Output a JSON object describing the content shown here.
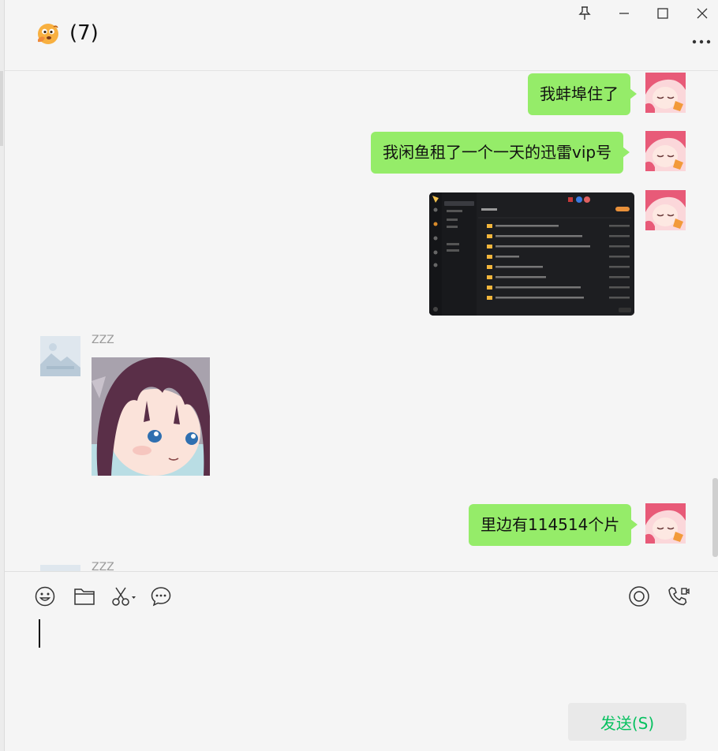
{
  "header": {
    "title": "(7)",
    "emoji_icon": "thinking-face-icon"
  },
  "window_controls": [
    "pin-icon",
    "minimize-icon",
    "maximize-icon",
    "close-icon"
  ],
  "messages": [
    {
      "direction": "out",
      "type": "text",
      "text": "我蚌埠住了"
    },
    {
      "direction": "out",
      "type": "text",
      "text": "我闲鱼租了一个一天的迅雷vip号"
    },
    {
      "direction": "out",
      "type": "image",
      "description": "screenshot"
    },
    {
      "direction": "in",
      "sender": "ZZZ",
      "type": "image",
      "description": "sticker"
    },
    {
      "direction": "out",
      "type": "text",
      "text": "里边有114514个片"
    },
    {
      "direction": "in",
      "sender": "ZZZ",
      "type": "partial"
    }
  ],
  "toolbar": {
    "left": [
      "emoji-icon",
      "folder-icon",
      "scissors-icon",
      "chat-history-icon"
    ],
    "right": [
      "live-icon",
      "call-icon"
    ]
  },
  "compose": {
    "value": "",
    "send_label": "发送(S)"
  },
  "colors": {
    "bubble_out": "#95ec69",
    "send_text": "#07c160",
    "background": "#f5f5f5"
  }
}
